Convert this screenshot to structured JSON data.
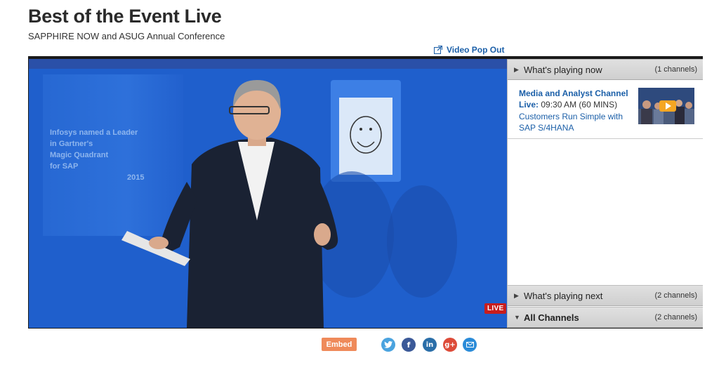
{
  "page": {
    "title": "Best of the Event Live",
    "subtitle": "SAPPHIRE NOW and ASUG Annual Conference",
    "popout_label": "Video Pop Out"
  },
  "video": {
    "live_label": "LIVE",
    "screen_text": [
      "Infosys named a Leader",
      "in Gartner's",
      "Magic Quadrant",
      "for SAP",
      "2015"
    ]
  },
  "sidebar": {
    "now": {
      "label": "What's playing now",
      "count": "(1 channels)"
    },
    "now_item": {
      "channel": "Media and Analyst Channel",
      "live_prefix": "Live:",
      "time": "09:30 AM (60 MINS)",
      "topic": "Customers Run Simple with SAP S/4HANA"
    },
    "next": {
      "label": "What's playing next",
      "count": "(2 channels)"
    },
    "all": {
      "label": "All Channels",
      "count": "(2 channels)"
    }
  },
  "share": {
    "embed_label": "Embed",
    "icons": [
      "twitter-icon",
      "facebook-icon",
      "linkedin-icon",
      "google-plus-icon",
      "email-icon"
    ]
  },
  "colors": {
    "link_blue": "#1b5fa8",
    "live_red": "#c81d1d",
    "embed_orange": "#ef8a5a",
    "twitter": "#4aa3df",
    "facebook": "#3b5998",
    "linkedin": "#2a6ea8",
    "google_plus": "#dd4b39",
    "email": "#2a8bd8"
  }
}
